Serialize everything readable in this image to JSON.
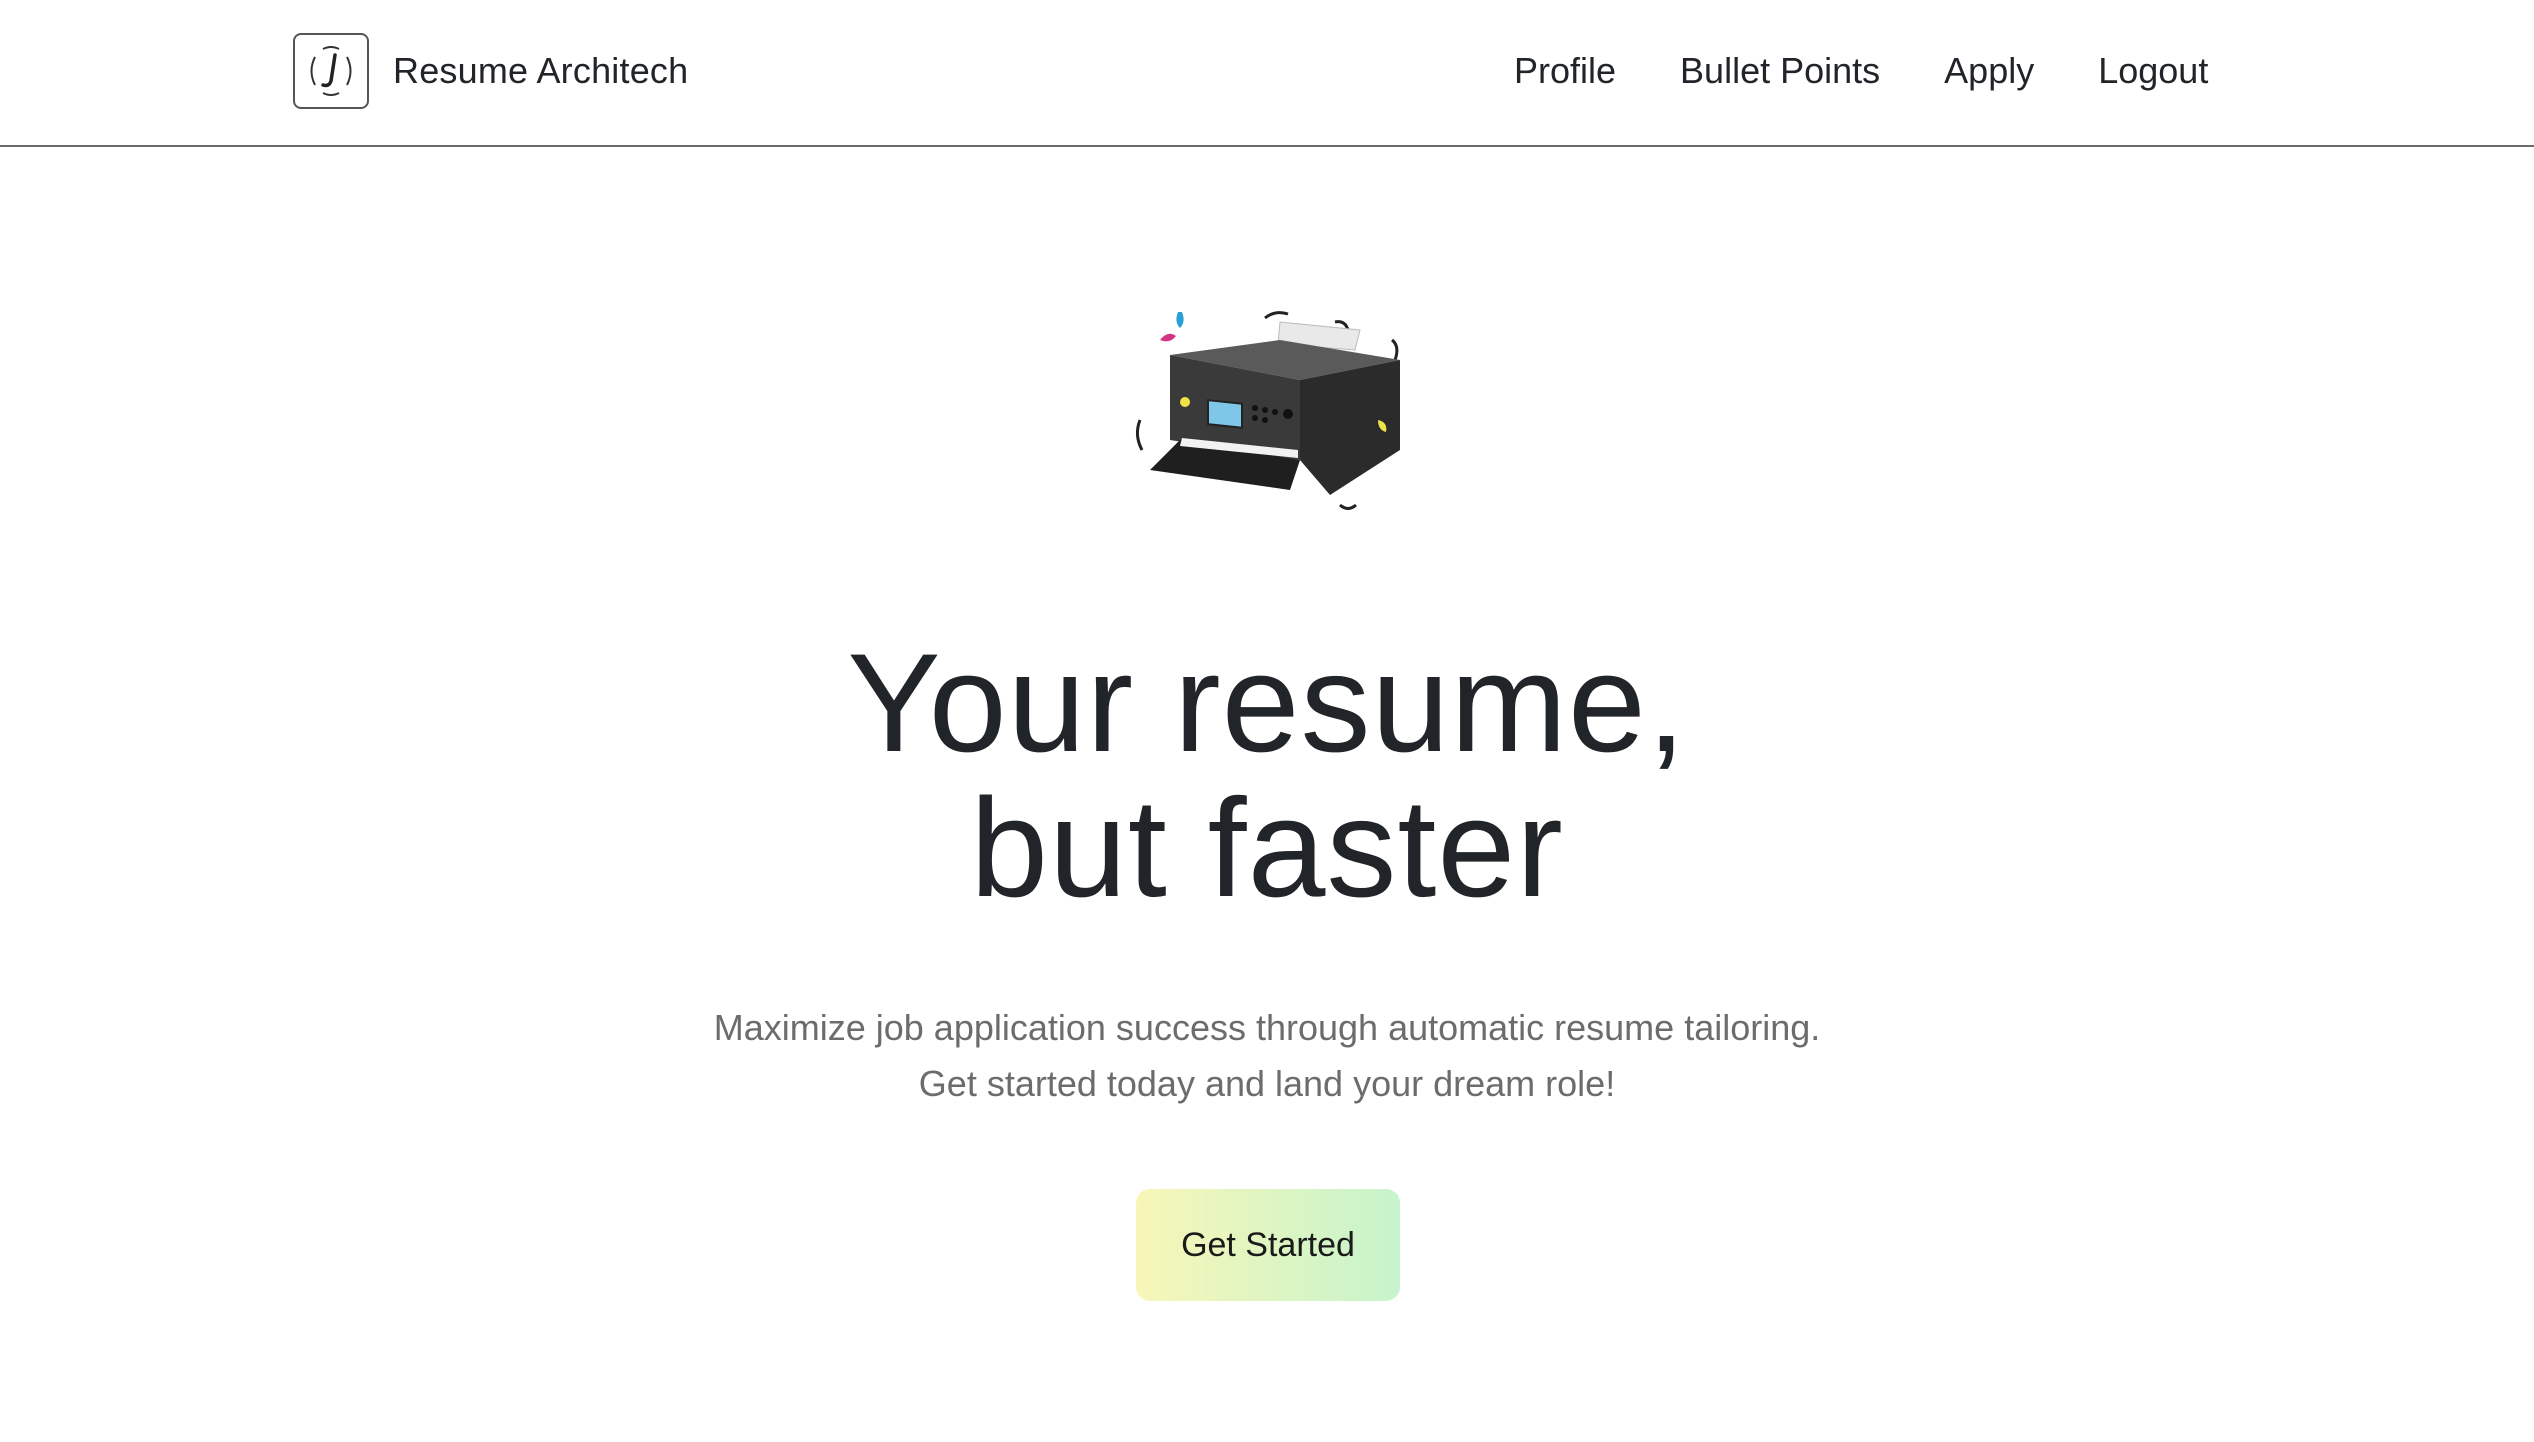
{
  "header": {
    "brand_name": "Resume Architech",
    "logo_icon": "logo-icon",
    "nav": [
      {
        "label": "Profile"
      },
      {
        "label": "Bullet Points"
      },
      {
        "label": "Apply"
      },
      {
        "label": "Logout"
      }
    ]
  },
  "hero": {
    "image_icon": "printer-illustration",
    "headline_line1": "Your resume,",
    "headline_line2": "but faster",
    "subtext_line1": "Maximize job application success through automatic resume tailoring.",
    "subtext_line2": "Get started today and land your dream role!",
    "cta_label": "Get Started"
  },
  "colors": {
    "cta_gradient_start": "#f8f6b8",
    "cta_gradient_end": "#c6f4cc",
    "text": "#212529",
    "muted_text": "#6c6c6c"
  }
}
